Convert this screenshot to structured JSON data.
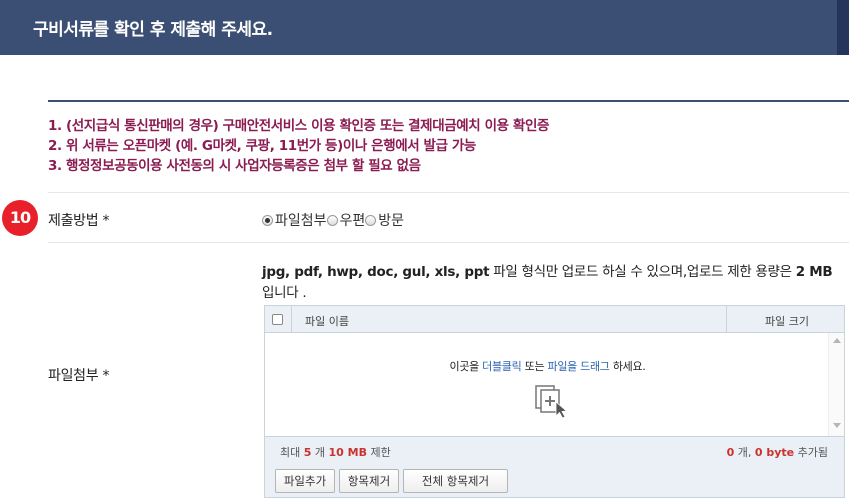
{
  "header": {
    "title": "구비서류를 확인 후 제출해 주세요."
  },
  "notices": [
    "1. (선지급식 통신판매의 경우) 구매안전서비스 이용 확인증 또는 결제대금예치 이용 확인증",
    "2. 위 서류는 오픈마켓 (예. G마켓, 쿠팡, 11번가 등)이나 은행에서 발급 가능",
    "3. 행정정보공동이용 사전동의 시 사업자등록증은 첨부 할 필요 없음"
  ],
  "step_badge": "10",
  "submission": {
    "label": "제출방법 *",
    "options": [
      {
        "label": "파일첨부",
        "checked": true
      },
      {
        "label": "우편",
        "checked": false
      },
      {
        "label": "방문",
        "checked": false
      }
    ]
  },
  "attachment": {
    "label": "파일첨부 *",
    "description_bold": "jpg, pdf, hwp, doc, gul, xls, ppt",
    "description_mid": " 파일 형식만 업로드 하실 수 있으며,업로드 제한 용량은 ",
    "description_size": "2 MB",
    "description_end": "입니다 ."
  },
  "uploader": {
    "col_name": "파일 이름",
    "col_size": "파일 크기",
    "drop_pre": "이곳을 ",
    "drop_hl1": "더블클릭",
    "drop_mid": " 또는 ",
    "drop_hl2": "파일을 드래그",
    "drop_post": " 하세요.",
    "limit_pre": "최대 ",
    "limit_count": "5",
    "limit_mid": " 개 ",
    "limit_size": "10 MB",
    "limit_post": " 제한",
    "added_count": "0",
    "added_mid": " 개, ",
    "added_size": "0 byte",
    "added_post": " 추가됨"
  },
  "buttons": {
    "add": "파일추가",
    "remove": "항목제거",
    "remove_all": "전체 항목제거"
  }
}
